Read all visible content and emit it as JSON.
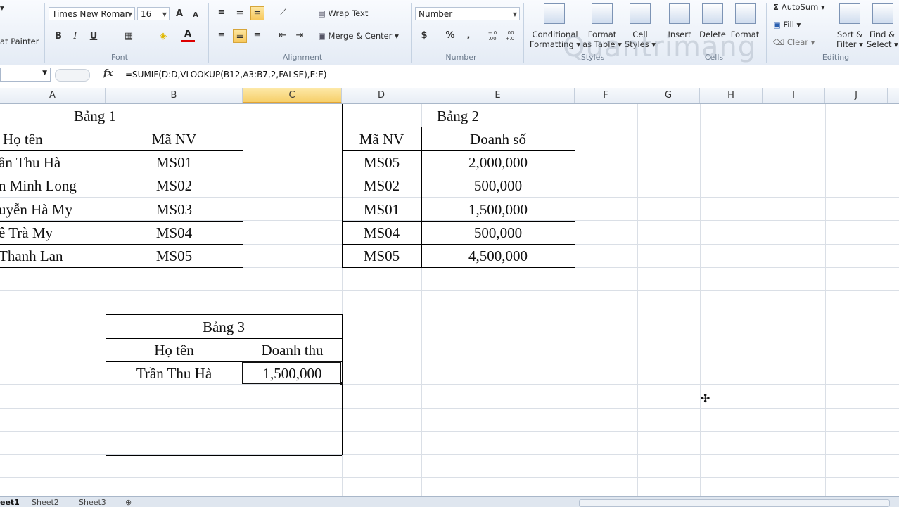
{
  "ribbon": {
    "clipboard": {
      "format_painter": "at Painter"
    },
    "font": {
      "name": "Times New Roman",
      "size": "16",
      "group_label": "Font",
      "bold": "B",
      "italic": "I",
      "underline": "U",
      "grow": "A",
      "shrink": "A",
      "font_color": "A"
    },
    "alignment": {
      "wrap_text": "Wrap Text",
      "merge_center": "Merge & Center",
      "group_label": "Alignment"
    },
    "number": {
      "format": "Number",
      "group_label": "Number",
      "currency": "$",
      "percent": "%",
      "comma": ",",
      "increase_decimal": "+.0 .00",
      "decrease_decimal": ".00 +.0"
    },
    "styles": {
      "conditional": "Conditional",
      "conditional2": "Formatting",
      "format_as": "Format",
      "format_as2": "as Table",
      "cell": "Cell",
      "cell2": "Styles",
      "group_label": "Styles"
    },
    "cells": {
      "insert": "Insert",
      "delete": "Delete",
      "format": "Format",
      "group_label": "Cells"
    },
    "editing": {
      "autosum": "AutoSum",
      "fill": "Fill",
      "clear": "Clear",
      "sort": "Sort &",
      "sort2": "Filter",
      "find": "Find &",
      "find2": "Select",
      "group_label": "Editing"
    },
    "watermark": "Quantrimang"
  },
  "formula_bar": {
    "fx": "fx",
    "formula": "=SUMIF(D:D,VLOOKUP(B12,A3:B7,2,FALSE),E:E)"
  },
  "columns": [
    "A",
    "B",
    "C",
    "D",
    "E",
    "F",
    "G",
    "H",
    "I",
    "J"
  ],
  "table1": {
    "title": "Bảng 1",
    "headers": [
      "Họ tên",
      "Mã NV"
    ],
    "rows": [
      [
        "ần Thu Hà",
        "MS01"
      ],
      [
        "n Minh Long",
        "MS02"
      ],
      [
        "uyễn Hà My",
        "MS03"
      ],
      [
        "ê Trà My",
        "MS04"
      ],
      [
        " Thanh Lan",
        "MS05"
      ]
    ]
  },
  "table2": {
    "title": "Bảng 2",
    "headers": [
      "Mã NV",
      "Doanh số"
    ],
    "rows": [
      [
        "MS05",
        "2,000,000"
      ],
      [
        "MS02",
        "500,000"
      ],
      [
        "MS01",
        "1,500,000"
      ],
      [
        "MS04",
        "500,000"
      ],
      [
        "MS05",
        "4,500,000"
      ]
    ]
  },
  "table3": {
    "title": "Bảng 3",
    "headers": [
      "Họ tên",
      "Doanh thu"
    ],
    "rows": [
      [
        "Trần Thu Hà",
        "1,500,000"
      ]
    ]
  },
  "sheets": [
    "eet1",
    "Sheet2",
    "Sheet3"
  ]
}
